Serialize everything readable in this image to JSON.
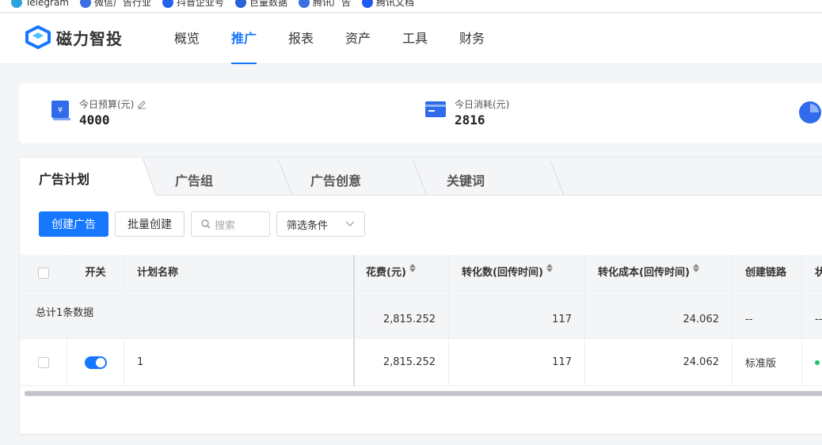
{
  "bookmarks": [
    {
      "label": "Telegram",
      "color": "#2aa3df"
    },
    {
      "label": "微信广告行业",
      "color": "#3b6fe0"
    },
    {
      "label": "抖音企业号",
      "color": "#2463eb"
    },
    {
      "label": "巨量数据",
      "color": "#2a62d8"
    },
    {
      "label": "腾讯广告",
      "color": "#3b6fe0"
    },
    {
      "label": "腾讯文档",
      "color": "#1e5cf0"
    }
  ],
  "app": {
    "logo_text": "磁力智投",
    "brand_color": "#1677ff"
  },
  "nav": {
    "items": [
      "概览",
      "推广",
      "报表",
      "资产",
      "工具",
      "财务"
    ],
    "active": "推广"
  },
  "summary": {
    "budget_label": "今日预算(元)",
    "budget_value": "4000",
    "spend_label": "今日消耗(元)",
    "spend_value": "2816"
  },
  "tabs": [
    "广告计划",
    "广告组",
    "广告创意",
    "关键词"
  ],
  "toolbar": {
    "create_label": "创建广告",
    "batch_label": "批量创建",
    "search_placeholder": "搜索",
    "filter_label": "筛选条件"
  },
  "table": {
    "headers": {
      "switch": "开关",
      "name": "计划名称",
      "cost": "花费(元)",
      "conversions": "转化数(回传时间)",
      "cpa": "转化成本(回传时间)",
      "link": "创建链路",
      "status": "状"
    },
    "total": {
      "label": "总计1条数据",
      "cost": "2,815.252",
      "conversions": "117",
      "cpa": "24.062",
      "link": "--",
      "status": "--"
    },
    "rows": [
      {
        "switch_on": true,
        "name": "1",
        "cost": "2,815.252",
        "conversions": "117",
        "cpa": "24.062",
        "link": "标准版"
      }
    ]
  }
}
